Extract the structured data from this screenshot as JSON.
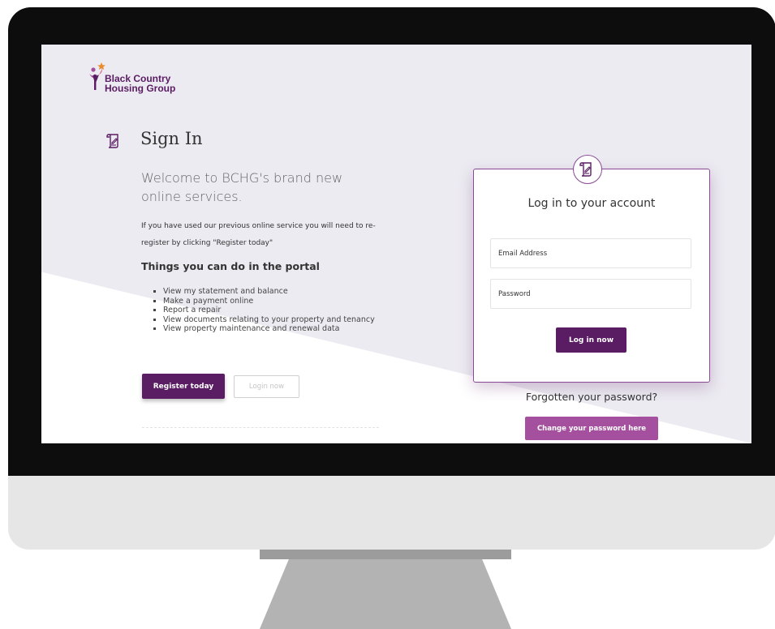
{
  "brand": {
    "line1": "Black Country",
    "line2": "Housing Group",
    "color": "#5a1c63",
    "accent": "#a4509f",
    "logo_icon": "bchg-logo-figure-icon"
  },
  "signin": {
    "icon": "scroll-document-icon",
    "title": "Sign In"
  },
  "welcome": "Welcome to BCHG's brand new online services.",
  "info_text": "If you have used our previous online service you will need to re-register by clicking \"Register today\"",
  "features": {
    "title": "Things you can do in the portal",
    "items": [
      "View my statement and balance",
      "Make a payment online",
      "Report a repair",
      "View documents relating to your property and tenancy",
      "View property maintenance and renewal data"
    ]
  },
  "actions": {
    "register_label": "Register today",
    "login_now_label": "Login now"
  },
  "login_card": {
    "icon": "scroll-document-icon",
    "title": "Log in to your account",
    "email_placeholder": "Email Address",
    "password_placeholder": "Password",
    "submit_label": "Log in now"
  },
  "forgot": {
    "text": "Forgotten your password?",
    "button_label": "Change your password here"
  }
}
